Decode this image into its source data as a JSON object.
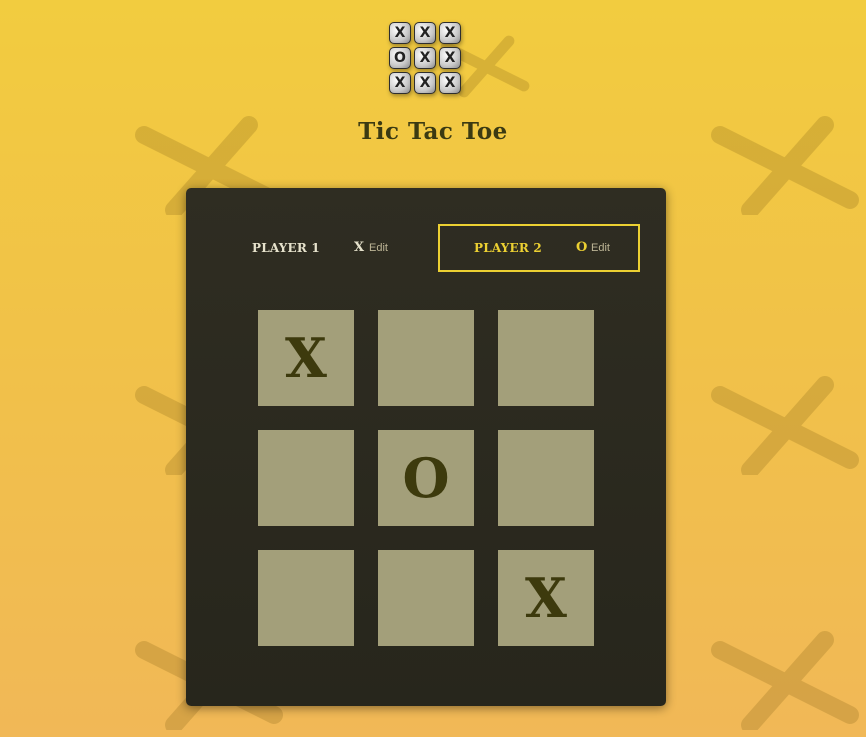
{
  "app": {
    "title": "Tic Tac Toe",
    "logo_tiles": [
      "X",
      "X",
      "X",
      "O",
      "X",
      "X",
      "X",
      "X",
      "X"
    ]
  },
  "background_glyph": "X",
  "players": [
    {
      "name": "PLAYER 1",
      "symbol": "X",
      "edit_label": "Edit",
      "active": false
    },
    {
      "name": "PLAYER 2",
      "symbol": "O",
      "edit_label": "Edit",
      "active": true
    }
  ],
  "board": [
    [
      "X",
      "",
      ""
    ],
    [
      "",
      "O",
      ""
    ],
    [
      "",
      "",
      "X"
    ]
  ],
  "colors": {
    "background_top": "#f2cc3f",
    "background_bottom": "#f1b857",
    "panel": "#2c2a20",
    "cell": "#a39f7a",
    "mark": "#3d3a0d",
    "active_accent": "#ecd032",
    "title": "#3b3a12"
  }
}
